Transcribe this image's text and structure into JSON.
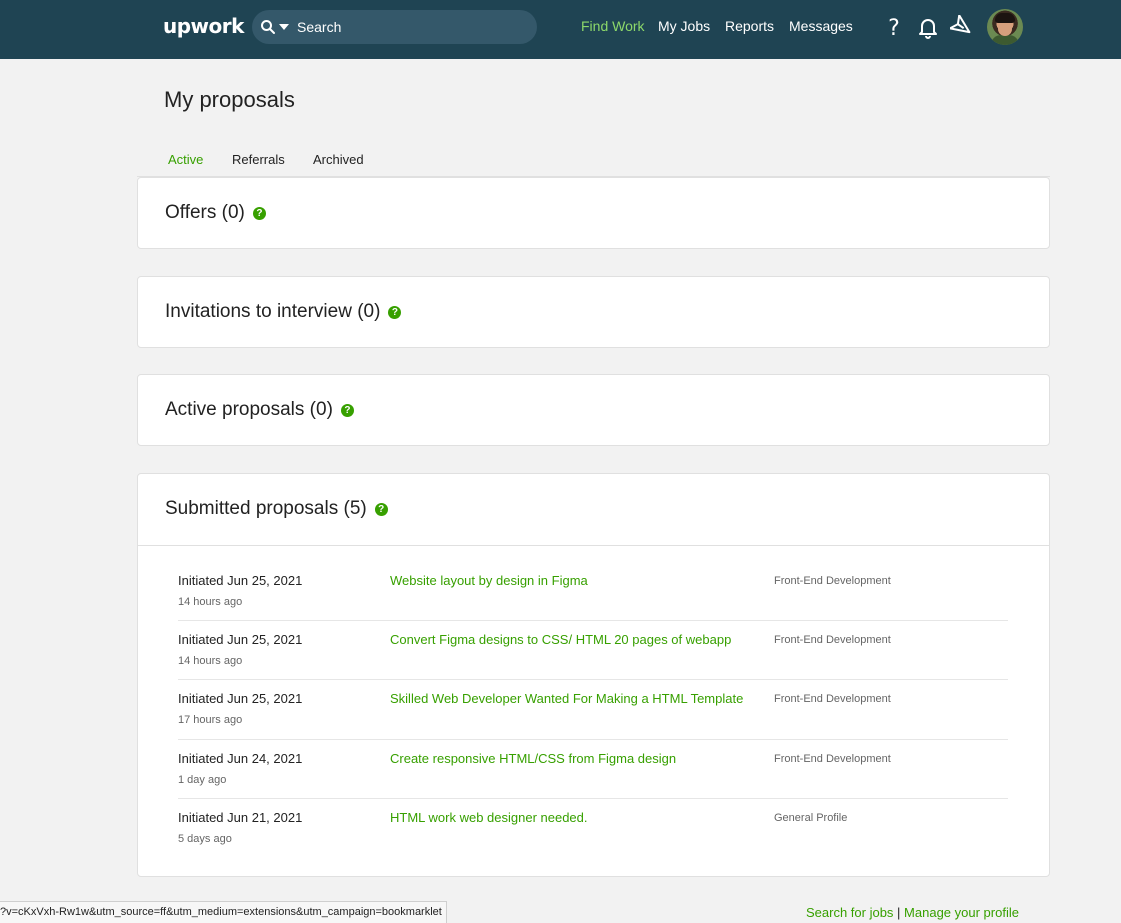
{
  "header": {
    "logo": "upwork",
    "search_placeholder": "Search",
    "nav": {
      "find_work": "Find Work",
      "my_jobs": "My Jobs",
      "reports": "Reports",
      "messages": "Messages"
    },
    "icons": [
      "help-icon",
      "bell-icon",
      "send-icon"
    ],
    "accent_color": "#8cd86a",
    "bg_color": "#1f4453"
  },
  "page": {
    "title": "My proposals",
    "tabs": [
      "Active",
      "Referrals",
      "Archived"
    ]
  },
  "sections": {
    "offers": "Offers (0)",
    "invitations": "Invitations to interview (0)",
    "active": "Active proposals (0)",
    "submitted": "Submitted proposals (5)"
  },
  "help_glyph": "?",
  "proposals": [
    {
      "initiated": "Initiated Jun 25, 2021",
      "ago": "14 hours ago",
      "title": "Website layout by design in Figma",
      "category": "Front-End Development"
    },
    {
      "initiated": "Initiated Jun 25, 2021",
      "ago": "14 hours ago",
      "title": "Convert Figma designs to CSS/ HTML 20 pages of webapp",
      "category": "Front-End Development"
    },
    {
      "initiated": "Initiated Jun 25, 2021",
      "ago": "17 hours ago",
      "title": "Skilled Web Developer Wanted For Making a HTML Template",
      "category": "Front-End Development"
    },
    {
      "initiated": "Initiated Jun 24, 2021",
      "ago": "1 day ago",
      "title": "Create responsive HTML/CSS from Figma design",
      "category": "Front-End Development"
    },
    {
      "initiated": "Initiated Jun 21, 2021",
      "ago": "5 days ago",
      "title": "HTML work web designer needed.",
      "category": "General Profile"
    }
  ],
  "footer": {
    "status_url": "?v=cKxVxh-Rw1w&utm_source=ff&utm_medium=extensions&utm_campaign=bookmarklet",
    "search_jobs": "Search for jobs",
    "separator": " | ",
    "manage_profile": "Manage your profile"
  },
  "brand_green": "#37a000"
}
